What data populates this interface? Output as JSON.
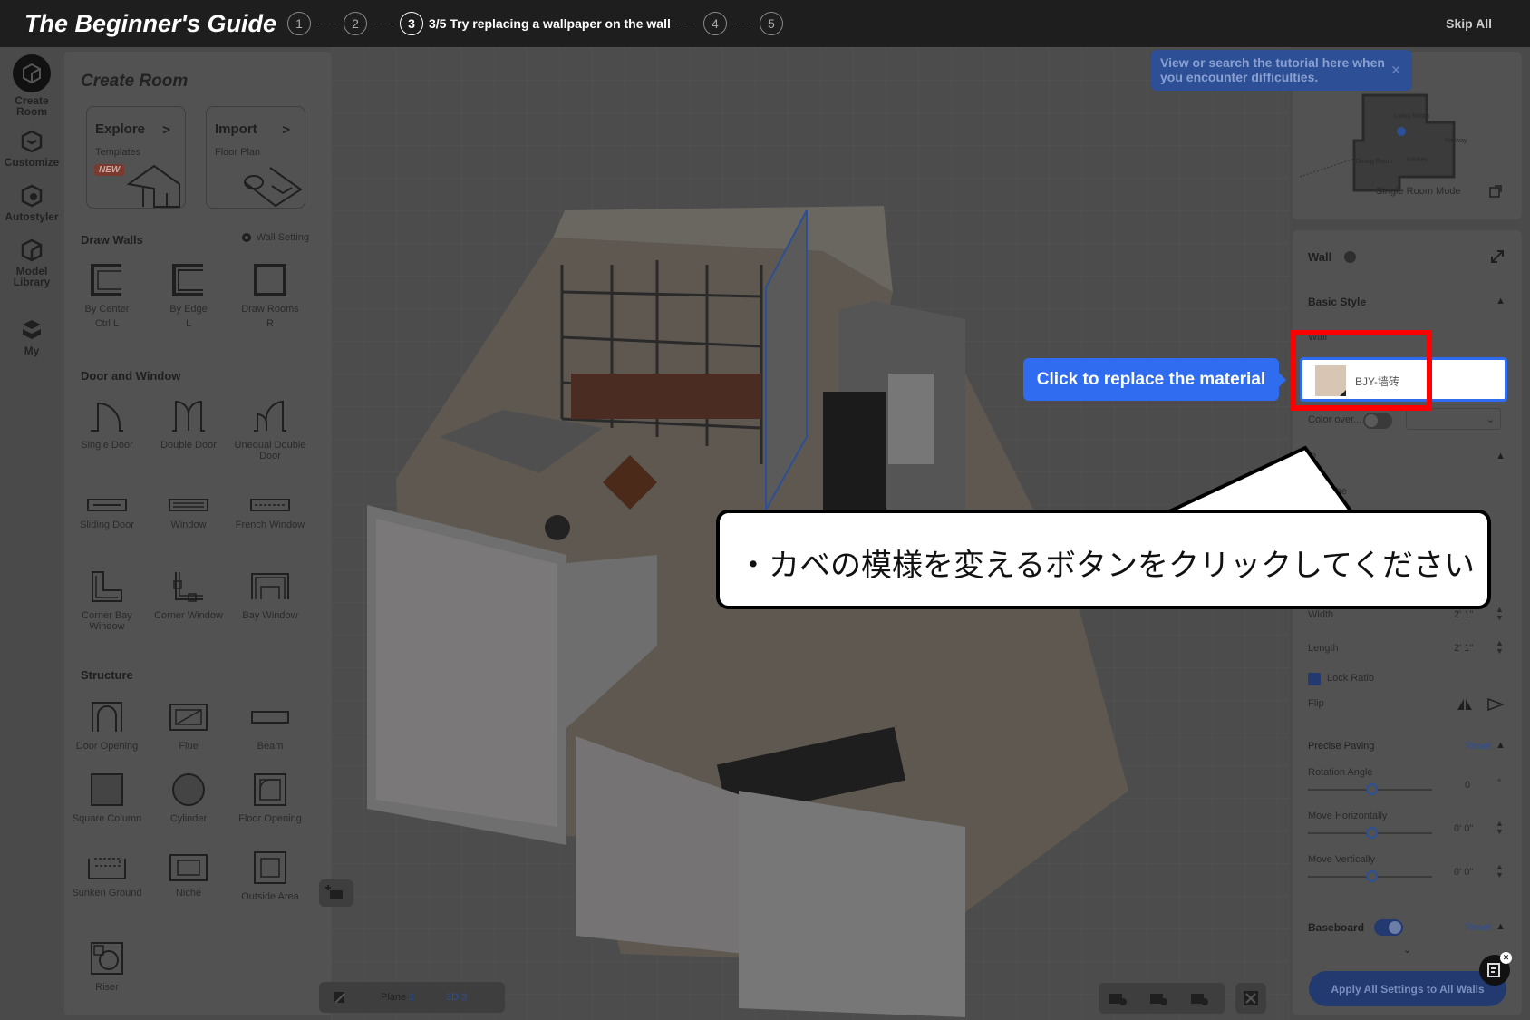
{
  "topbar": {
    "title": "The Beginner's Guide",
    "steps": [
      "1",
      "2",
      "3",
      "4",
      "5"
    ],
    "active_step_text": "3/5 Try replacing a wallpaper on the wall",
    "skip_all": "Skip All"
  },
  "rail": {
    "items": [
      {
        "label1": "Create",
        "label2": "Room",
        "icon": "create-room-icon"
      },
      {
        "label1": "Customize",
        "label2": "",
        "icon": "customize-icon"
      },
      {
        "label1": "Autostyler",
        "label2": "",
        "icon": "autostyler-icon"
      },
      {
        "label1": "Model",
        "label2": "Library",
        "icon": "model-library-icon"
      },
      {
        "label1": "My",
        "label2": "",
        "icon": "my-icon"
      }
    ]
  },
  "panel": {
    "title": "Create Room",
    "cards": [
      {
        "title": "Explore",
        "sub": "Templates",
        "badge": "NEW"
      },
      {
        "title": "Import",
        "sub": "Floor Plan"
      }
    ],
    "draw_walls": {
      "title": "Draw Walls",
      "setting": "Wall Setting",
      "tools": [
        {
          "label": "By Center",
          "key": "Ctrl L"
        },
        {
          "label": "By Edge",
          "key": "L"
        },
        {
          "label": "Draw Rooms",
          "key": "R"
        }
      ]
    },
    "door_window": {
      "title": "Door and Window",
      "tools": [
        "Single Door",
        "Double Door",
        "Unequal Double Door",
        "Sliding Door",
        "Window",
        "French Window",
        "Corner Bay Window",
        "Corner Window",
        "Bay Window"
      ]
    },
    "structure": {
      "title": "Structure",
      "tools": [
        "Door Opening",
        "Flue",
        "Beam",
        "Square Column",
        "Cylinder",
        "Floor Opening",
        "Sunken Ground",
        "Niche",
        "Outside Area",
        "Riser"
      ]
    }
  },
  "canvas": {
    "view_plane": "Plane",
    "view_plane_key": "1",
    "view_3d": "3D",
    "view_3d_key": "3"
  },
  "minimap": {
    "mode": "Single Room Mode",
    "rooms": [
      "Living Room",
      "Hallway",
      "Dining Room",
      "Kitchen"
    ]
  },
  "tutorial_tip": "View or search the tutorial here when you encounter difficulties.",
  "props": {
    "title": "Wall",
    "basic_style": "Basic Style",
    "wall_label": "Wall",
    "material_name": "BJY-墙砖",
    "color_over": "Color over...",
    "partial_text1": "e",
    "partial_text2": "ch the",
    "width_label": "Width",
    "width_value": "2' 1\"",
    "length_label": "Length",
    "length_value": "2' 1\"",
    "lock_ratio": "Lock Ratio",
    "flip": "Flip",
    "precise_paving": "Precise Paving",
    "reset": "Reset",
    "rotation_angle": "Rotation Angle",
    "rotation_value": "0",
    "rotation_unit": "°",
    "move_h": "Move Horizontally",
    "move_h_value": "0' 0\"",
    "move_v": "Move Vertically",
    "move_v_value": "0' 0\"",
    "baseboard": "Baseboard",
    "apply_all": "Apply All Settings to All Walls"
  },
  "blue_tip": "Click to replace the material",
  "callout": "・カベの模様を変えるボタンをクリックしてください",
  "colors": {
    "accent": "#2f6cf0",
    "highlight": "#ff0000",
    "topbar": "#1e1e1e"
  }
}
